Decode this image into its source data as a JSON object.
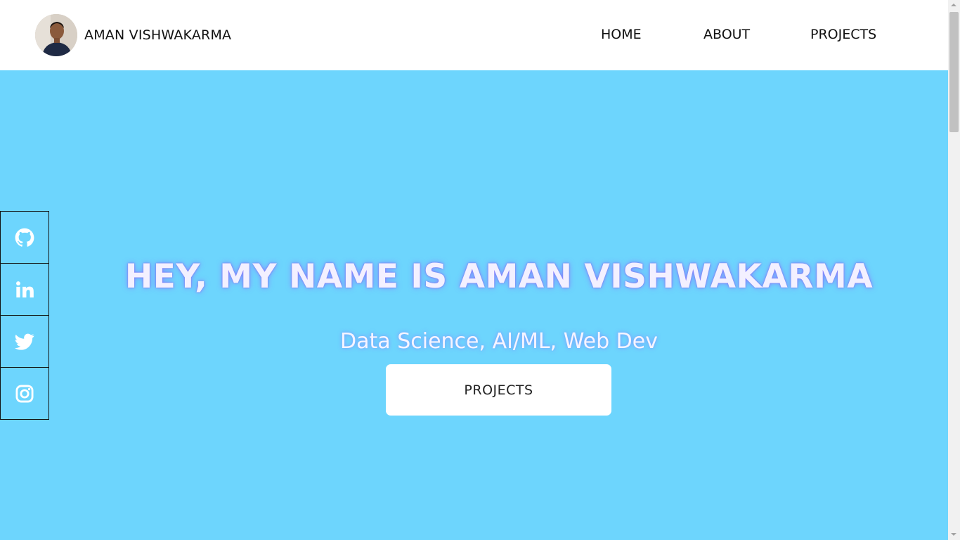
{
  "header": {
    "brand_name": "AMAN VISHWAKARMA",
    "avatar_icon": "profile-photo",
    "nav": [
      {
        "label": "HOME"
      },
      {
        "label": "ABOUT"
      },
      {
        "label": "PROJECTS"
      }
    ]
  },
  "hero": {
    "title": "HEY, MY NAME IS AMAN VISHWAKARMA",
    "subtitle": "Data Science, AI/ML, Web Dev",
    "button_label": "PROJECTS"
  },
  "social": [
    {
      "icon": "github-icon"
    },
    {
      "icon": "linkedin-icon"
    },
    {
      "icon": "twitter-icon"
    },
    {
      "icon": "instagram-icon"
    }
  ],
  "colors": {
    "hero_background": "#6dd5fd",
    "header_background": "#ffffff",
    "title_text": "#f3f0ff",
    "title_glow": "#8c6eff",
    "button_background": "#ffffff"
  }
}
